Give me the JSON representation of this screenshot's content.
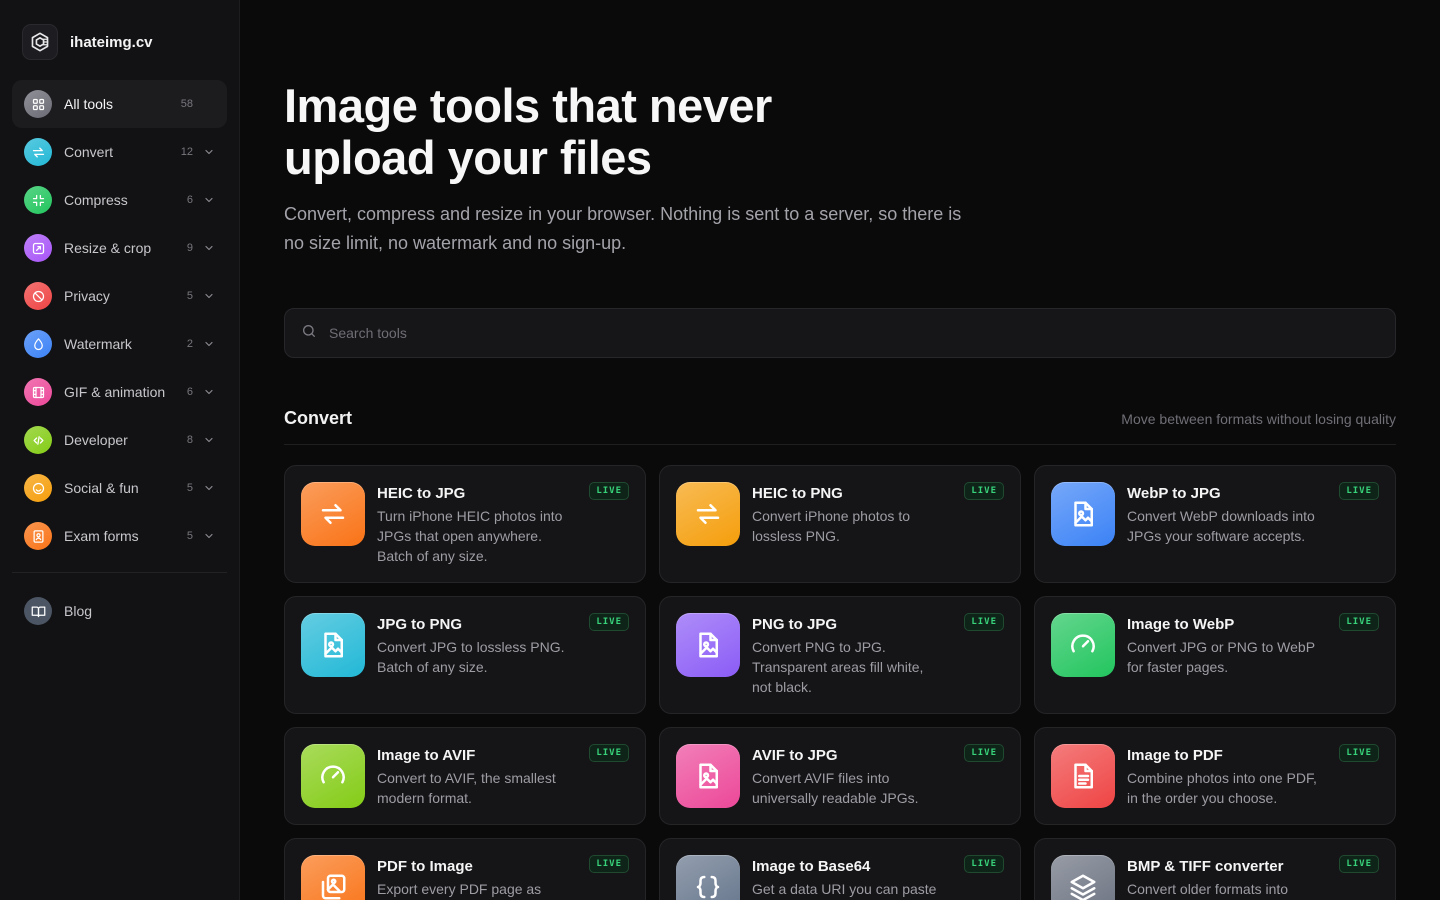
{
  "brand": {
    "name": "ihateimg.cv"
  },
  "sidebar": {
    "items": [
      {
        "label": "All tools",
        "count": "58",
        "icon": "grid-icon",
        "color": "#6b6b75",
        "active": true,
        "chevron": false
      },
      {
        "label": "Convert",
        "count": "12",
        "icon": "convert-icon",
        "color": "#22b8d6",
        "chevron": true
      },
      {
        "label": "Compress",
        "count": "6",
        "icon": "compress-icon",
        "color": "#22c55e",
        "chevron": true
      },
      {
        "label": "Resize & crop",
        "count": "9",
        "icon": "crop-icon",
        "color": "#a855f7",
        "chevron": true
      },
      {
        "label": "Privacy",
        "count": "5",
        "icon": "privacy-icon",
        "color": "#ef4444",
        "chevron": true
      },
      {
        "label": "Watermark",
        "count": "2",
        "icon": "droplet-icon",
        "color": "#3b82f6",
        "chevron": true
      },
      {
        "label": "GIF & animation",
        "count": "6",
        "icon": "film-icon",
        "color": "#ec4899",
        "chevron": true
      },
      {
        "label": "Developer",
        "count": "8",
        "icon": "code-icon",
        "color": "#84cc16",
        "chevron": true
      },
      {
        "label": "Social & fun",
        "count": "5",
        "icon": "smile-icon",
        "color": "#f59e0b",
        "chevron": true
      },
      {
        "label": "Exam forms",
        "count": "5",
        "icon": "id-card-icon",
        "color": "#f97316",
        "chevron": true
      }
    ],
    "blog": {
      "label": "Blog",
      "icon": "book-icon",
      "color": "#6b7280"
    }
  },
  "hero": {
    "title_line1": "Image tools that never",
    "title_line2": "upload your files",
    "subtitle": "Convert, compress and resize in your browser. Nothing is sent to a server, so there is no size limit, no watermark and no sign-up."
  },
  "search": {
    "placeholder": "Search tools",
    "value": ""
  },
  "section": {
    "title": "Convert",
    "description": "Move between formats without losing quality"
  },
  "tools": [
    {
      "title": "HEIC to JPG",
      "desc": "Turn iPhone HEIC photos into JPGs that open anywhere. Batch of any size.",
      "badge": "LIVE",
      "icon": "convert-icon",
      "color": "#f97316"
    },
    {
      "title": "HEIC to PNG",
      "desc": "Convert iPhone photos to lossless PNG.",
      "badge": "LIVE",
      "icon": "convert-icon",
      "color": "#f59e0b"
    },
    {
      "title": "WebP to JPG",
      "desc": "Convert WebP downloads into JPGs your software accepts.",
      "badge": "LIVE",
      "icon": "image-file-icon",
      "color": "#3b82f6"
    },
    {
      "title": "JPG to PNG",
      "desc": "Convert JPG to lossless PNG. Batch of any size.",
      "badge": "LIVE",
      "icon": "image-file-icon",
      "color": "#22b8d6"
    },
    {
      "title": "PNG to JPG",
      "desc": "Convert PNG to JPG. Transparent areas fill white, not black.",
      "badge": "LIVE",
      "icon": "image-file-icon",
      "color": "#8b5cf6"
    },
    {
      "title": "Image to WebP",
      "desc": "Convert JPG or PNG to WebP for faster pages.",
      "badge": "LIVE",
      "icon": "gauge-icon",
      "color": "#22c55e"
    },
    {
      "title": "Image to AVIF",
      "desc": "Convert to AVIF, the smallest modern format.",
      "badge": "LIVE",
      "icon": "gauge-icon",
      "color": "#84cc16"
    },
    {
      "title": "AVIF to JPG",
      "desc": "Convert AVIF files into universally readable JPGs.",
      "badge": "LIVE",
      "icon": "image-file-icon",
      "color": "#ec4899"
    },
    {
      "title": "Image to PDF",
      "desc": "Combine photos into one PDF, in the order you choose.",
      "badge": "LIVE",
      "icon": "document-icon",
      "color": "#ef4444"
    },
    {
      "title": "PDF to Image",
      "desc": "Export every PDF page as JPG or PNG.",
      "badge": "LIVE",
      "icon": "images-icon",
      "color": "#f97316"
    },
    {
      "title": "Image to Base64",
      "desc": "Get a data URI you can paste straight into CSS or HTML.",
      "badge": "LIVE",
      "icon": "braces-icon",
      "color": "#64748b"
    },
    {
      "title": "BMP & TIFF converter",
      "desc": "Convert older formats into JPG, PNG or WebP.",
      "badge": "LIVE",
      "icon": "layers-icon",
      "color": "#6b7280"
    }
  ]
}
